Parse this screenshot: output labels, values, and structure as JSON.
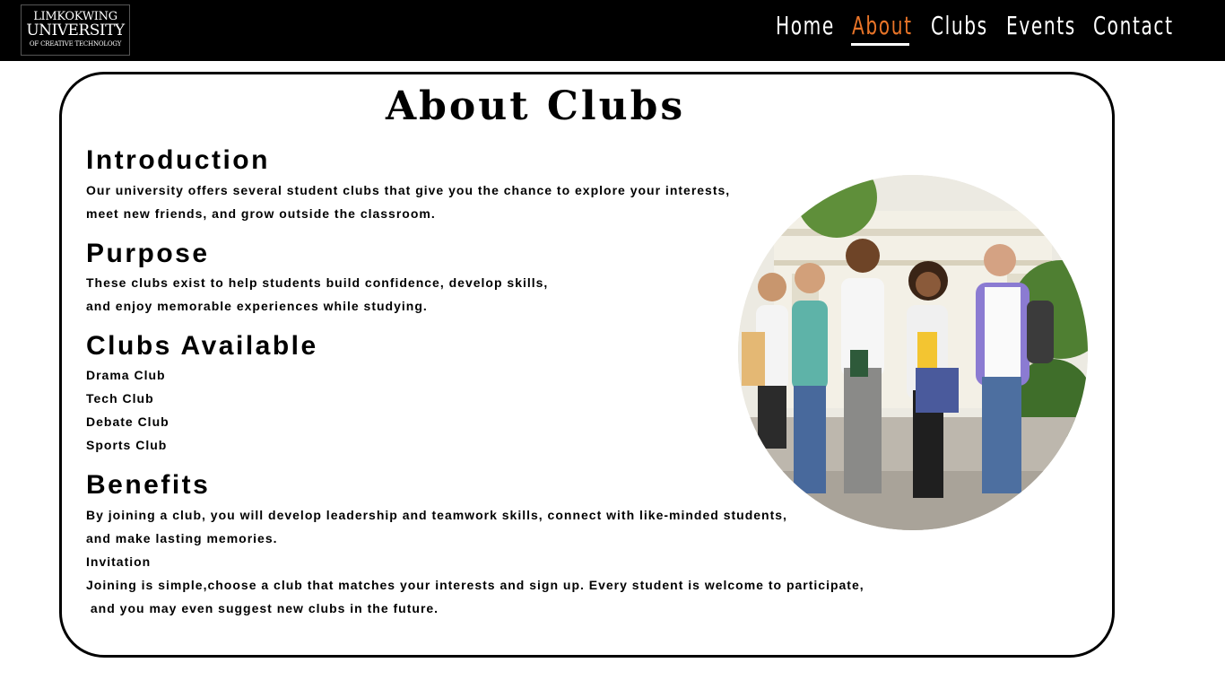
{
  "logo": {
    "line1": "LIMKOKWING",
    "line2": "UNIVERSITY",
    "line3": "OF CREATIVE TECHNOLOGY"
  },
  "nav": {
    "items": [
      {
        "label": "Home",
        "active": false
      },
      {
        "label": "About",
        "active": true
      },
      {
        "label": "Clubs",
        "active": false
      },
      {
        "label": "Events",
        "active": false
      },
      {
        "label": "Contact",
        "active": false
      }
    ],
    "active_color": "#e87428"
  },
  "main": {
    "title": "About Clubs",
    "introduction": {
      "heading": "Introduction",
      "lines": [
        "Our university offers several student clubs that give you the chance to explore your interests,",
        "meet new friends, and grow outside the classroom."
      ]
    },
    "purpose": {
      "heading": "Purpose",
      "lines": [
        "These clubs exist to help students build confidence, develop skills,",
        "and enjoy memorable experiences while studying."
      ]
    },
    "clubs_available": {
      "heading": "Clubs Available",
      "items": [
        "Drama Club",
        "Tech Club",
        "Debate Club",
        "Sports Club"
      ]
    },
    "benefits": {
      "heading": "Benefits",
      "lines": [
        "By joining a club, you will develop leadership and teamwork skills, connect with like-minded students,",
        "and make lasting memories.",
        "Invitation",
        "Joining is simple,choose a club that matches your interests and sign up. Every student is welcome to participate,",
        " and you may even suggest new clubs in the future."
      ]
    }
  }
}
